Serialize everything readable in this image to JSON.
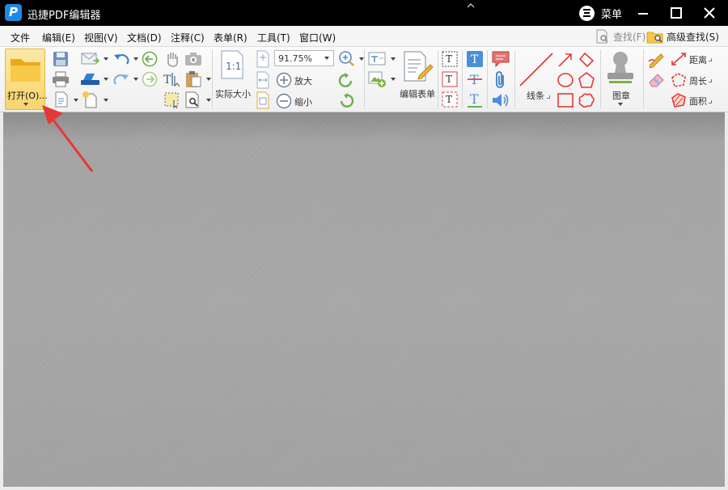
{
  "window": {
    "title": "迅捷PDF编辑器",
    "menu_label": "菜单"
  },
  "menubar": {
    "items": [
      "文件",
      "编辑(E)",
      "视图(V)",
      "文档(D)",
      "注释(C)",
      "表单(R)",
      "工具(T)",
      "窗口(W)"
    ],
    "find_label": "查找(F)",
    "advanced_find_label": "高级查找(S)"
  },
  "ribbon": {
    "open_label": "打开(O)...",
    "actual_size_label": "实际大小",
    "zoom_value": "91.75%",
    "zoom_in_label": "放大",
    "zoom_out_label": "缩小",
    "edit_form_label": "编辑表单",
    "lines_label": "线条",
    "stamp_label": "图章",
    "distance_label": "距离",
    "perimeter_label": "周长",
    "area_label": "面积"
  },
  "colors": {
    "titlebar": "#000000",
    "open_button": "#f8d46c",
    "annotation_red": "#e53935",
    "accent_blue": "#1e88e5",
    "workspace": "#a3a3a3"
  }
}
